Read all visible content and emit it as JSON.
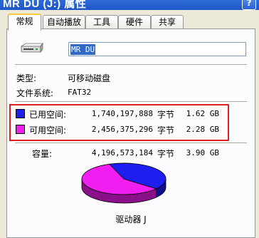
{
  "window": {
    "title": "MR DU (J:) 属性",
    "help_label": "?"
  },
  "tabs": [
    {
      "label": "常规",
      "active": true
    },
    {
      "label": "自动播放",
      "active": false
    },
    {
      "label": "工具",
      "active": false
    },
    {
      "label": "硬件",
      "active": false
    },
    {
      "label": "共享",
      "active": false
    }
  ],
  "drive": {
    "icon": "drive-icon",
    "name_value": "MR DU",
    "type_label": "类型:",
    "type_value": "可移动磁盘",
    "fs_label": "文件系统:",
    "fs_value": "FAT32"
  },
  "space": {
    "used": {
      "label": "已用空间:",
      "bytes": "1,740,197,888",
      "unit": "字节",
      "gb": "1.62 GB",
      "color": "#1e1ef0"
    },
    "free": {
      "label": "可用空间:",
      "bytes": "2,456,375,296",
      "unit": "字节",
      "gb": "2.28 GB",
      "color": "#f01ef0"
    },
    "capacity": {
      "label": "容量:",
      "bytes": "4,196,573,184",
      "unit": "字节",
      "gb": "3.90 GB"
    }
  },
  "pie": {
    "used_fraction": 0.4147,
    "used_color": "#1e1ef0",
    "used_side": "#10108a",
    "free_color": "#f01ef0",
    "free_side": "#8a108a"
  },
  "drive_label": "驱动器 J"
}
